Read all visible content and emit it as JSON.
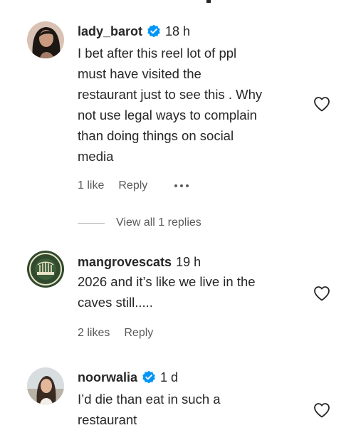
{
  "comments": [
    {
      "username": "lady_barot",
      "verified": true,
      "time": "18 h",
      "lines": [
        "I bet after this reel lot of ppl",
        "must have visited the",
        "restaurant just to see this . Why",
        "not use legal ways to complain",
        "than doing things on social",
        "media"
      ],
      "likes": "1 like",
      "reply_label": "Reply",
      "view_replies": "View all 1 replies"
    },
    {
      "username": "mangrovescats",
      "verified": false,
      "time": "19 h",
      "lines": [
        "2026 and it’s like we live in the",
        "caves still....."
      ],
      "likes": "2 likes",
      "reply_label": "Reply"
    },
    {
      "username": "noorwalia",
      "verified": true,
      "time": "1 d",
      "lines": [
        "I’d die than eat in such a",
        "restaurant"
      ]
    }
  ],
  "colors": {
    "text": "#262626",
    "secondary": "#5a5a5a",
    "verified_blue": "#0095f6"
  },
  "icons": {
    "verified": "verified-badge-icon",
    "like": "heart-icon",
    "more": "more-options-icon"
  }
}
